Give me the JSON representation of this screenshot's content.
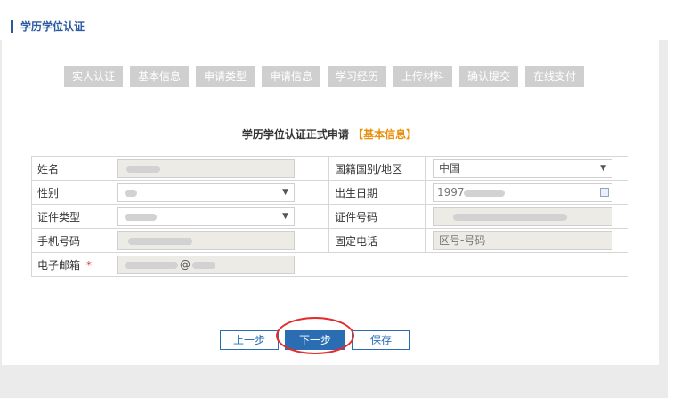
{
  "header": {
    "title": "学历学位认证"
  },
  "steps": [
    "实人认证",
    "基本信息",
    "申请类型",
    "申请信息",
    "学习经历",
    "上传材料",
    "确认提交",
    "在线支付"
  ],
  "form": {
    "title": "学历学位认证正式申请",
    "title_highlight": "【基本信息】",
    "name_label": "姓名",
    "nationality_label": "国籍国别/地区",
    "nationality_value": "中国",
    "gender_label": "性别",
    "birth_label": "出生日期",
    "birth_value_visible": "1997",
    "idtype_label": "证件类型",
    "idno_label": "证件号码",
    "phone_label": "手机号码",
    "tel_label": "固定电话",
    "tel_placeholder": "区号-号码",
    "email_label": "电子邮箱",
    "email_required": "*",
    "email_visible_char": "@"
  },
  "buttons": {
    "prev": "上一步",
    "next": "下一步",
    "save": "保存"
  }
}
